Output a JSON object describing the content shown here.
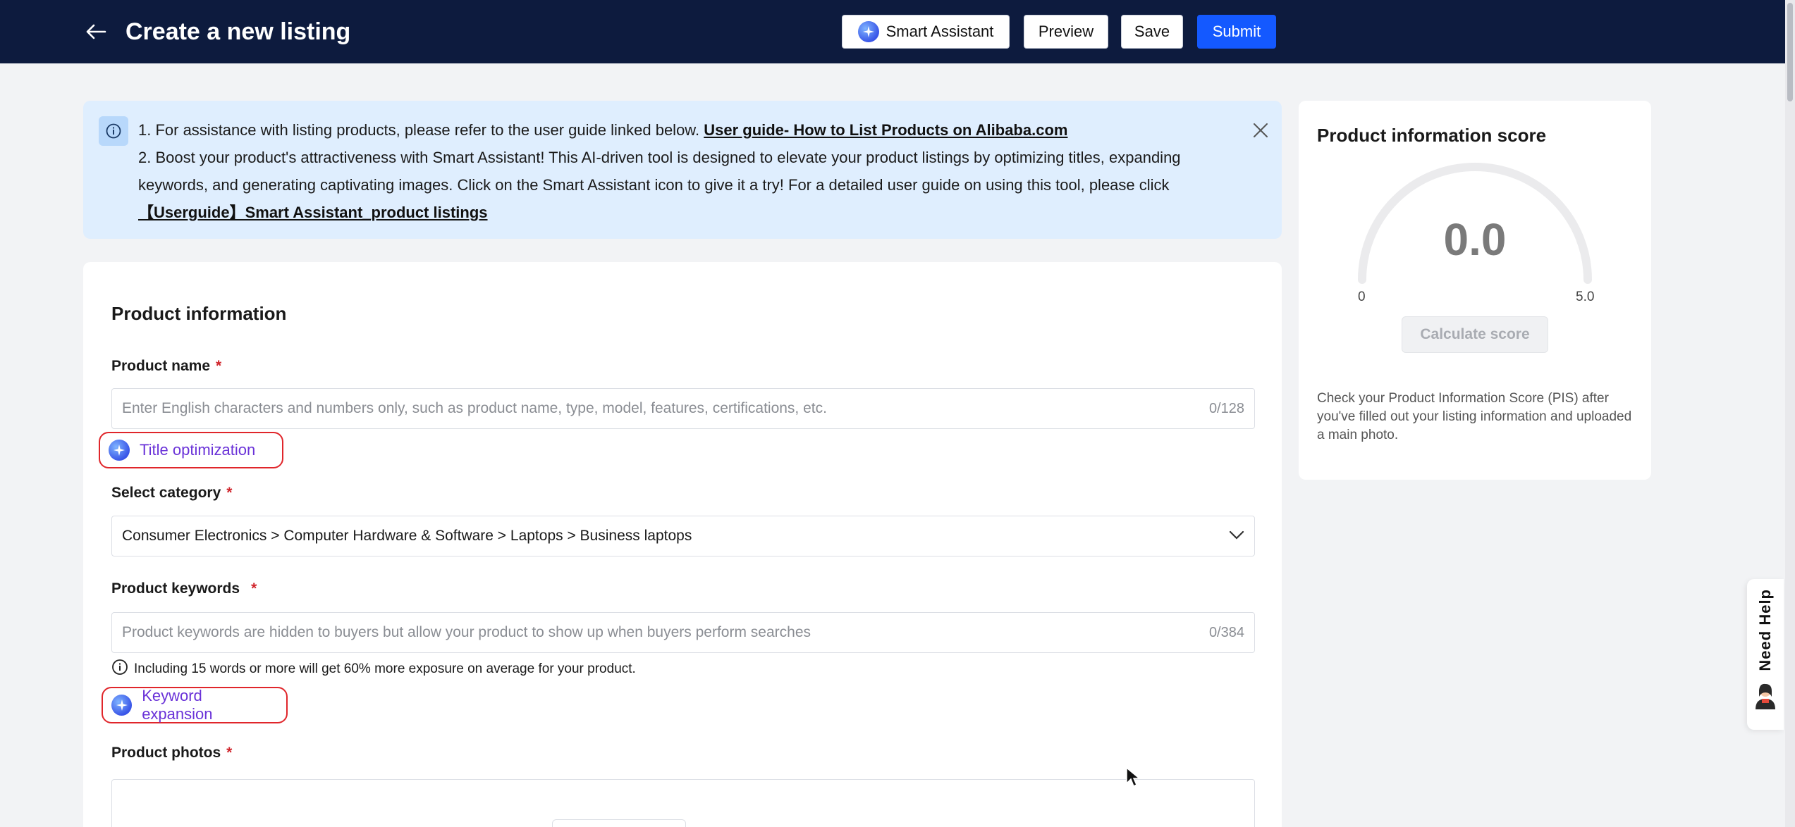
{
  "header": {
    "title": "Create a new listing",
    "smart_assistant": "Smart Assistant",
    "preview": "Preview",
    "save": "Save",
    "submit": "Submit",
    "submit_color": "#1459ff",
    "bar_color": "#0d1b3e"
  },
  "notice": {
    "line1": "1. For assistance with listing products, please refer to the user guide linked below. ",
    "line1_link": "User guide- How to List Products on Alibaba.com",
    "line2": "2. Boost your product's attractiveness with Smart Assistant! This AI-driven tool is designed to elevate your product listings by optimizing titles, expanding keywords, and generating captivating images. Click on the Smart Assistant icon to give it a try! For a detailed user guide on using this tool, please click",
    "line2_link": "【Userguide】Smart Assistant_product listings"
  },
  "form": {
    "section_title": "Product information",
    "product_name": {
      "label": "Product name",
      "required": "*",
      "placeholder": "Enter English characters and numbers only, such as product name, type, model, features, certifications, etc.",
      "count": "0/128",
      "ai_action": "Title optimization"
    },
    "category": {
      "label": "Select category",
      "required": "*",
      "value": "Consumer Electronics > Computer Hardware & Software > Laptops > Business laptops"
    },
    "keywords": {
      "label": "Product keywords",
      "required": "*",
      "placeholder": "Product keywords are hidden to buyers but allow your product to show up when buyers perform searches",
      "count": "0/384",
      "hint": "Including 15 words or more will get 60% more exposure on average for your product.",
      "ai_action": "Keyword expansion"
    },
    "photos": {
      "label": "Product photos",
      "required": "*"
    }
  },
  "score": {
    "title": "Product information score",
    "value": "0.0",
    "min": "0",
    "max": "5.0",
    "button": "Calculate score",
    "description": "Check your Product Information Score (PIS) after you've filled out your listing information and uploaded a main photo."
  },
  "help": {
    "label": "Need Help"
  }
}
